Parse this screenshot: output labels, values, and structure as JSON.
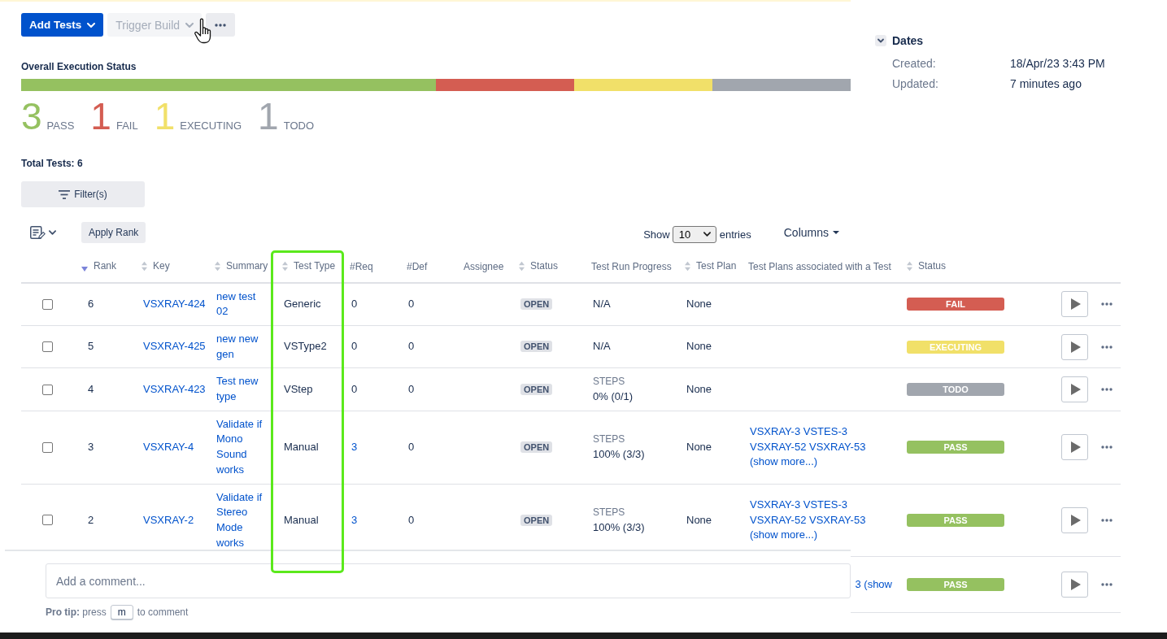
{
  "top_actions": [
    {
      "label": "Add Tests",
      "kind": "primary",
      "dropdown": true,
      "disabled": false
    },
    {
      "label": "Trigger Build",
      "kind": "default",
      "dropdown": true,
      "disabled": true
    },
    {
      "kind": "more",
      "dropdown": false,
      "disabled": false
    }
  ],
  "execution_status": {
    "title": "Overall Execution Status",
    "statuses": [
      {
        "count": "3",
        "label": "PASS",
        "color": "#95c160"
      },
      {
        "count": "1",
        "label": "FAIL",
        "color": "#d45d52"
      },
      {
        "count": "1",
        "label": "EXECUTING",
        "color": "#f1e069"
      },
      {
        "count": "1",
        "label": "TODO",
        "color": "#a1a6ae"
      }
    ]
  },
  "total_tests": "Total Tests: 6",
  "filter_button": {
    "label": "Filter(s)"
  },
  "dates": {
    "title": "Dates",
    "expanded": true,
    "fields": [
      {
        "label": "Created:",
        "value": "18/Apr/23 3:43 PM"
      },
      {
        "label": "Updated:",
        "value": "7 minutes ago"
      }
    ]
  },
  "table_toolbar": {
    "apply_rank": "Apply Rank",
    "show_label": "Show",
    "page_size": "10",
    "entries_label": "entries",
    "columns_button": "Columns"
  },
  "table": {
    "columns": [
      {
        "label": "Rank",
        "sortable": true,
        "sorted": true,
        "highlighted": false
      },
      {
        "label": "Key",
        "sortable": true,
        "sorted": false,
        "highlighted": false
      },
      {
        "label": "Summary",
        "sortable": true,
        "sorted": false,
        "highlighted": false
      },
      {
        "label": "Test Type",
        "sortable": true,
        "sorted": false,
        "highlighted": true
      },
      {
        "label": "#Req",
        "sortable": false,
        "highlighted": false
      },
      {
        "label": "#Def",
        "sortable": false,
        "highlighted": false
      },
      {
        "label": "Assignee",
        "sortable": false,
        "highlighted": false
      },
      {
        "label": "Status",
        "sortable": true,
        "sorted": false,
        "highlighted": false
      },
      {
        "label": "Test Run Progress",
        "sortable": false,
        "highlighted": false
      },
      {
        "label": "Test Plan",
        "sortable": true,
        "sorted": false,
        "highlighted": false
      },
      {
        "label": "Test Plans associated with a Test",
        "sortable": false,
        "highlighted": false
      },
      {
        "label": "Status",
        "sortable": true,
        "sorted": false,
        "highlighted": false
      }
    ],
    "rows": [
      {
        "kind": "full",
        "checked": false,
        "rank": "6",
        "key": "VSXRAY-424",
        "summary": "new test 02",
        "test_type": "Generic",
        "req": {
          "text": "0",
          "link": false
        },
        "def": "0",
        "status": "OPEN",
        "progress": {
          "kind": "text",
          "text": "N/A"
        },
        "test_plan": "None",
        "execution": {
          "label": "FAIL",
          "color": "#d45d52"
        }
      },
      {
        "kind": "full",
        "checked": false,
        "rank": "5",
        "key": "VSXRAY-425",
        "summary": "new new gen",
        "test_type": "VSType2",
        "req": {
          "text": "0",
          "link": false
        },
        "def": "0",
        "status": "OPEN",
        "progress": {
          "kind": "text",
          "text": "N/A"
        },
        "test_plan": "None",
        "execution": {
          "label": "EXECUTING",
          "color": "#f1e069"
        }
      },
      {
        "kind": "full",
        "checked": false,
        "rank": "4",
        "key": "VSXRAY-423",
        "summary": "Test new type",
        "test_type": "VStep",
        "req": {
          "text": "0",
          "link": false
        },
        "def": "0",
        "status": "OPEN",
        "progress": {
          "kind": "steps",
          "label": "STEPS",
          "text": "0% (0/1)"
        },
        "test_plan": "None",
        "execution": {
          "label": "TODO",
          "color": "#a1a6ae"
        }
      },
      {
        "kind": "full",
        "checked": false,
        "rank": "3",
        "key": "VSXRAY-4",
        "summary": "Validate if Mono Sound works",
        "test_type": "Manual",
        "req": {
          "text": "3",
          "link": true
        },
        "def": "0",
        "status": "OPEN",
        "progress": {
          "kind": "steps",
          "label": "STEPS",
          "text": "100% (3/3)"
        },
        "test_plan": "None",
        "plans": [
          "VSXRAY-3",
          "VSTES-3",
          "VSXRAY-52",
          "VSXRAY-53"
        ],
        "plans_more": "(show more...)",
        "execution": {
          "label": "PASS",
          "color": "#95c160"
        }
      },
      {
        "kind": "full",
        "checked": false,
        "rank": "2",
        "key": "VSXRAY-2",
        "summary": "Validate if Stereo Mode works",
        "test_type": "Manual",
        "req": {
          "text": "3",
          "link": true
        },
        "def": "0",
        "status": "OPEN",
        "progress": {
          "kind": "steps",
          "label": "STEPS",
          "text": "100% (3/3)"
        },
        "test_plan": "None",
        "plans": [
          "VSXRAY-3",
          "VSTES-3",
          "VSXRAY-52",
          "VSXRAY-53"
        ],
        "plans_more": "(show more...)",
        "execution": {
          "label": "PASS",
          "color": "#95c160"
        }
      },
      {
        "kind": "covered",
        "plans_fragment": "3 (show",
        "execution": {
          "label": "PASS",
          "color": "#95c160"
        }
      }
    ]
  },
  "comment": {
    "placeholder": "Add a comment...",
    "tip_before": "**Pro tip:** press",
    "tip_key": "m",
    "tip_after": "to comment"
  }
}
